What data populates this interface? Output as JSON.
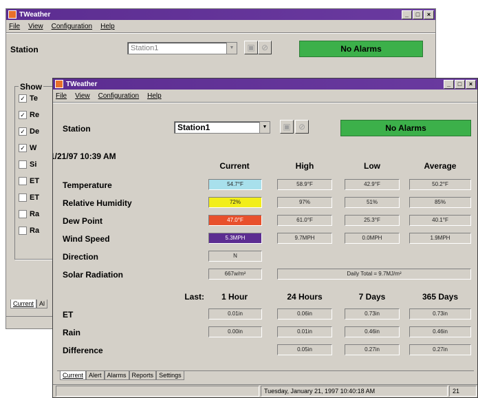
{
  "back_window": {
    "title": "TWeather",
    "menu": [
      "File",
      "View",
      "Configuration",
      "Help"
    ],
    "station_label": "Station",
    "station_value": "Station1",
    "alarm_text": "No Alarms",
    "show_label": "Show",
    "checkboxes": [
      {
        "label": "Te",
        "checked": true
      },
      {
        "label": "Re",
        "checked": true
      },
      {
        "label": "De",
        "checked": true
      },
      {
        "label": "W",
        "checked": true
      },
      {
        "label": "Si",
        "checked": false
      },
      {
        "label": "ET",
        "checked": false
      },
      {
        "label": "ET",
        "checked": false
      },
      {
        "label": "Ra",
        "checked": false
      },
      {
        "label": "Ra",
        "checked": false
      }
    ],
    "tabs": [
      "Current",
      "Al"
    ]
  },
  "front_window": {
    "title": "TWeather",
    "menu": [
      "File",
      "View",
      "Configuration",
      "Help"
    ],
    "station_label": "Station",
    "station_value": "Station1",
    "alarm_text": "No Alarms",
    "timestamp": "1/21/97 10:39 AM",
    "headers": [
      "Current",
      "High",
      "Low",
      "Average"
    ],
    "rows": [
      {
        "label": "Temperature",
        "current": "54.7°F",
        "high": "58.9°F",
        "low": "42.9°F",
        "average": "50.2°F",
        "color": "#a8e0ec"
      },
      {
        "label": "Relative Humidity",
        "current": "72%",
        "high": "97%",
        "low": "51%",
        "average": "85%",
        "color": "#f2ee1a"
      },
      {
        "label": "Dew Point",
        "current": "47.0°F",
        "high": "61.0°F",
        "low": "25.3°F",
        "average": "40.1°F",
        "color": "#e8502c"
      },
      {
        "label": "Wind Speed",
        "current": "5.3MPH",
        "high": "9.7MPH",
        "low": "0.0MPH",
        "average": "1.9MPH",
        "color": "#5c2d91"
      }
    ],
    "direction": {
      "label": "Direction",
      "value": "N"
    },
    "solar": {
      "label": "Solar Radiation",
      "value": "667w/m²",
      "daily_total": "Daily Total = 9.7MJ/m²"
    },
    "period_headers": [
      "Last:",
      "1 Hour",
      "24 Hours",
      "7 Days",
      "365 Days"
    ],
    "period_rows": [
      {
        "label": "ET",
        "values": [
          "0.01in",
          "0.06in",
          "0.73in",
          "0.73in"
        ]
      },
      {
        "label": "Rain",
        "values": [
          "0.00in",
          "0.01in",
          "0.46in",
          "0.46in"
        ]
      },
      {
        "label": "Difference",
        "values": [
          "",
          "0.05in",
          "0.27in",
          "0.27in"
        ]
      }
    ],
    "tabs": [
      "Current",
      "Alert",
      "Alarms",
      "Reports",
      "Settings"
    ],
    "status_date": "Tuesday, January 21, 1997  10:40:18 AM",
    "status_extra": "21"
  }
}
